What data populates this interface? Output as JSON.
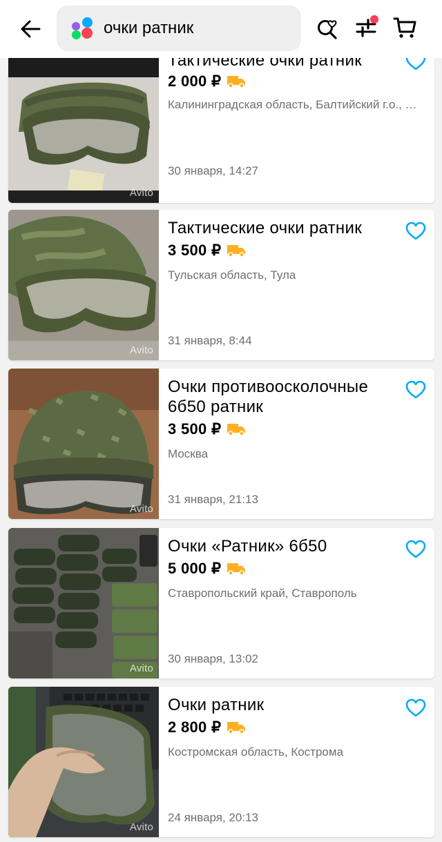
{
  "header": {
    "search_query": "очки ратник",
    "back_icon": "arrow-left-icon",
    "saved_search_icon": "search-heart-icon",
    "filters_icon": "sliders-icon",
    "cart_icon": "cart-icon",
    "logo_colors": [
      "#04e061",
      "#ff4053",
      "#965eeb",
      "#0af"
    ]
  },
  "listings": [
    {
      "title": "Тактические очки ратник",
      "price": "2 000 ₽",
      "location": "Калининградская область, Балтийский г.о., …",
      "date": "30 января, 14:27",
      "watermark": "Avito",
      "delivery_icon": "truck-icon",
      "favorite_icon": "heart-outline-icon"
    },
    {
      "title": "Тактические очки ратник",
      "price": "3 500 ₽",
      "location": "Тульская область, Тула",
      "date": "31 января, 8:44",
      "watermark": "Avito",
      "delivery_icon": "truck-icon",
      "favorite_icon": "heart-outline-icon"
    },
    {
      "title": "Очки противоосколочные 6б50 ратник",
      "price": "3 500 ₽",
      "location": "Москва",
      "date": "31 января, 21:13",
      "watermark": "Avito",
      "delivery_icon": "truck-icon",
      "favorite_icon": "heart-outline-icon"
    },
    {
      "title": "Очки «Ратник» 6б50",
      "price": "5 000 ₽",
      "location": "Ставропольский край, Ставрополь",
      "date": "30 января, 13:02",
      "watermark": "Avito",
      "delivery_icon": "truck-icon",
      "favorite_icon": "heart-outline-icon"
    },
    {
      "title": "Очки ратник",
      "price": "2 800 ₽",
      "location": "Костромская область, Кострома",
      "date": "24 января, 20:13",
      "watermark": "Avito",
      "delivery_icon": "truck-icon",
      "favorite_icon": "heart-outline-icon"
    }
  ],
  "colors": {
    "accent": "#00aaff",
    "delivery": "#ffb021",
    "secondary_text": "#6f6f6f",
    "notification_dot": "#ff4053"
  }
}
